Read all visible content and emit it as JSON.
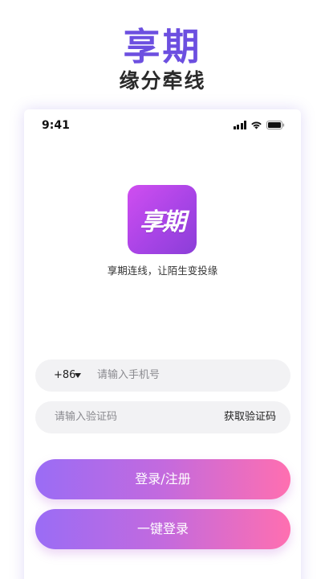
{
  "promo": {
    "title": "享期",
    "subtitle": "缘分牵线"
  },
  "status_bar": {
    "time": "9:41",
    "icons": [
      "signal-icon",
      "wifi-icon",
      "battery-icon"
    ]
  },
  "app": {
    "logo_text": "享期",
    "slogan": "享期连线，让陌生变投缘",
    "logo_gradient": [
      "#d04ef0",
      "#8b3ed8"
    ]
  },
  "form": {
    "country_code": "+86",
    "phone_placeholder": "请输入手机号",
    "code_placeholder": "请输入验证码",
    "get_code_label": "获取验证码"
  },
  "buttons": {
    "register_label": "登录/注册",
    "one_click_label": "一键登录"
  },
  "colors": {
    "accent": "#6c4fe0",
    "button_gradient_start": "#9a6cf5",
    "button_gradient_end": "#ff6fb0"
  }
}
